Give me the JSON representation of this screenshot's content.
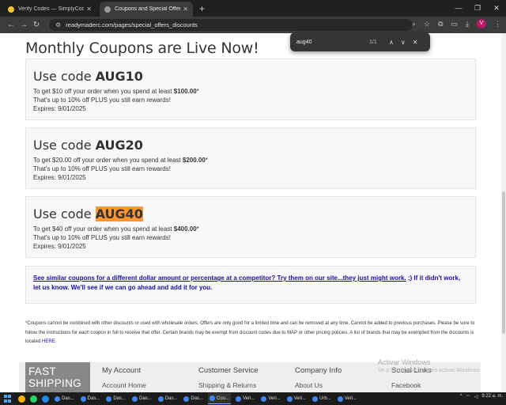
{
  "browser": {
    "tabs": [
      {
        "title": "Verify Codes — SimplyCodes",
        "active": false,
        "color": "#f4c430"
      },
      {
        "title": "Coupons and Special Offers - r",
        "active": true,
        "color": "#5a5a5a"
      }
    ],
    "url": "readymaderc.com/pages/special_offers_discounts",
    "profile_initial": "V",
    "find": {
      "query": "aug40",
      "count": "1/1"
    }
  },
  "page": {
    "heading": "Monthly Coupons are Live Now!",
    "coupons": [
      {
        "prefix": "Use code ",
        "code": "AUG10",
        "line1_pre": "To get $10 off your order when you spend at least ",
        "line1_bold": "$100.00",
        "line1_post": "*",
        "line2": "That's up to 10% off PLUS you still earn rewards!",
        "expires": "Expires: 9/01/2025",
        "highlighted": false
      },
      {
        "prefix": "Use code ",
        "code": "AUG20",
        "line1_pre": "To get $20.00 off your order when you spend at least ",
        "line1_bold": "$200.00",
        "line1_post": "*",
        "line2": "That's up to 10% off PLUS you still earn rewards!",
        "expires": "Expires: 9/01/2025",
        "highlighted": false
      },
      {
        "prefix": "Use code ",
        "code": "AUG40",
        "line1_pre": "To get $40 off your order when you spend at least ",
        "line1_bold": "$400.00",
        "line1_post": "*",
        "line2": "That's up to 10% off PLUS you still earn rewards!",
        "expires": "Expires: 9/01/2025",
        "highlighted": true
      }
    ],
    "info_link": "See similar coupons for a different dollar amount or percentage at a competitor? Try them on our site...they just might work.",
    "info_rest": " ;) If it didn't work, let us know. We'll see if we can go ahead and add it for you.",
    "fine_print": "*Coupons cannot be combined with other discounts or used with wholesale orders. Offers are only good for a limited time and can be removed at any time. Cannot be added to previous purchases. Please be sure to follow the instructions for each coupon in full to receive that offer. Certain brands may be exempt from discount codes due to MAP or other pricing policies. A list of brands that may be exempted from the discounts is located ",
    "fine_link": "HERE",
    "fine_end": "."
  },
  "footer": {
    "banner": "FAST SHIPPING",
    "columns": [
      {
        "title": "My Account",
        "item": "Account Home"
      },
      {
        "title": "Customer Service",
        "item": "Shipping & Returns"
      },
      {
        "title": "Company Info",
        "item": "About Us"
      },
      {
        "title": "Social Links",
        "item": "Facebook"
      }
    ]
  },
  "watermark": {
    "line1": "Activar Windows",
    "line2": "Ve a Configuración para activar Windows."
  },
  "taskbar": {
    "items": [
      "Das...",
      "Das...",
      "Das...",
      "Das...",
      "Das...",
      "Das...",
      "Cou...",
      "Veri...",
      "Veri...",
      "Veri...",
      "Urb...",
      "Veri..."
    ],
    "time": "9:22 a. m."
  }
}
